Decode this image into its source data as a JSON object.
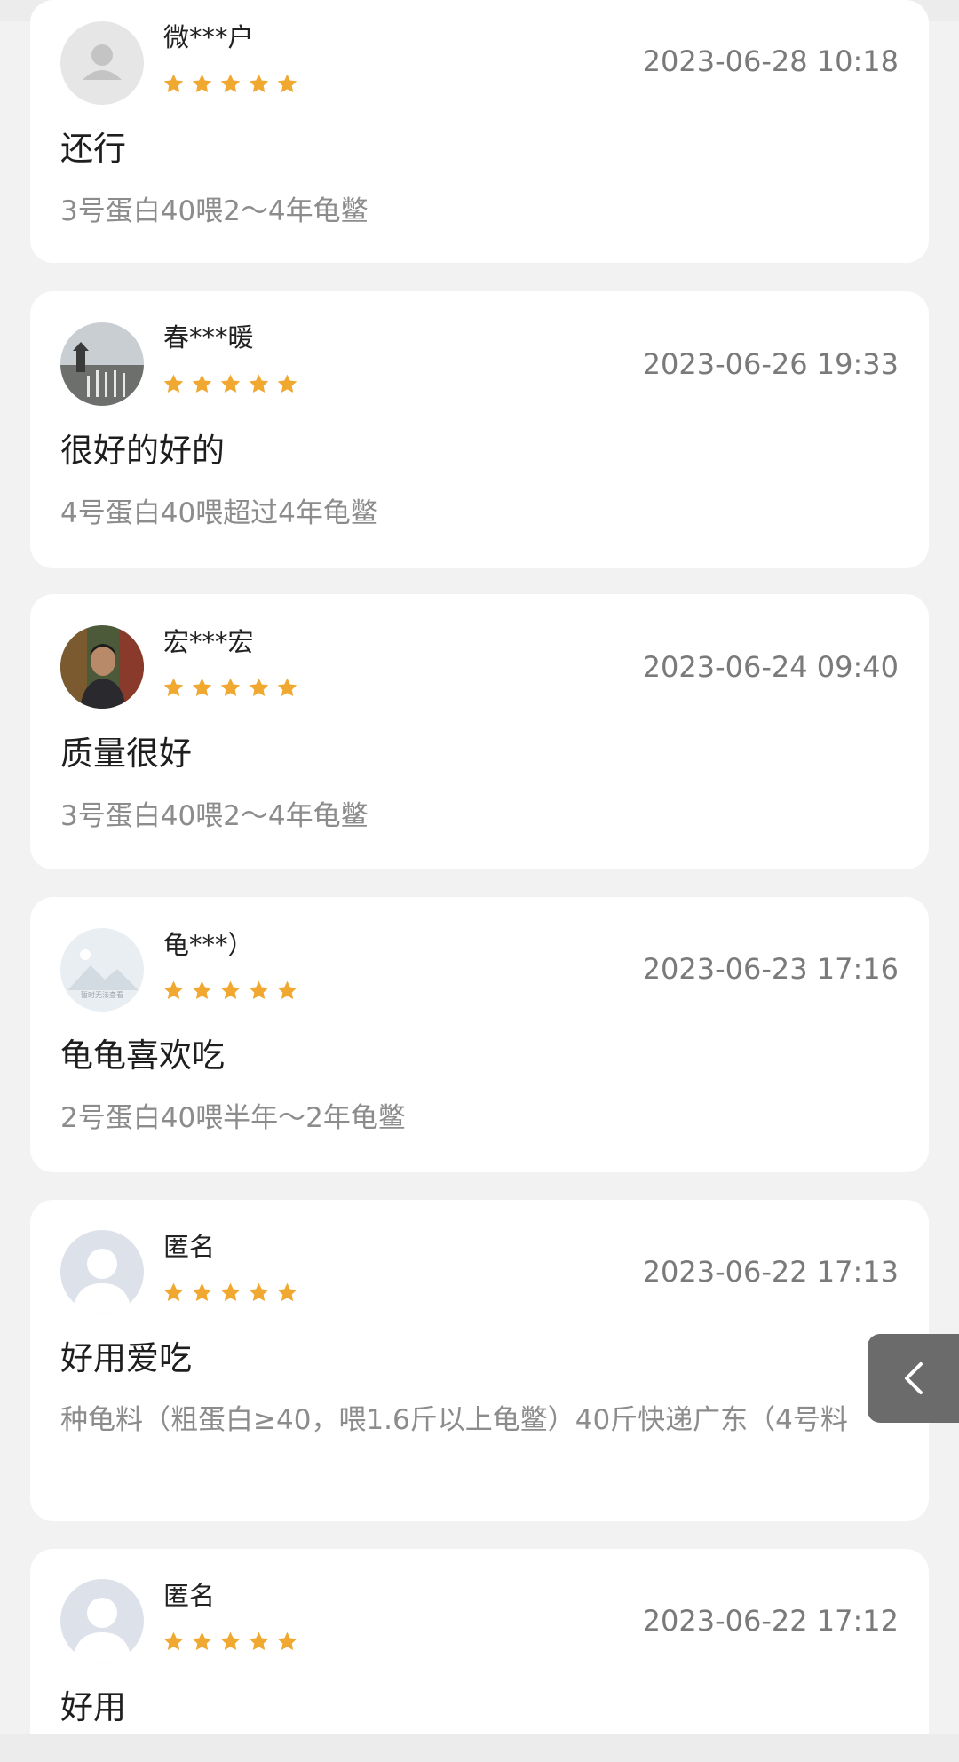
{
  "reviews": [
    {
      "username": "微***户",
      "rating": 5,
      "date": "2023-06-28 10:18",
      "comment": "还行",
      "spec": "3号蛋白40喂2～4年龟鳖",
      "avatar": "default-user-avatar"
    },
    {
      "username": "春***暖",
      "rating": 5,
      "date": "2023-06-26 19:33",
      "comment": "很好的好的",
      "spec": "4号蛋白40喂超过4年龟鳖",
      "avatar": "landscape-photo-avatar"
    },
    {
      "username": "宏***宏",
      "rating": 5,
      "date": "2023-06-24 09:40",
      "comment": "质量很好",
      "spec": "3号蛋白40喂2～4年龟鳖",
      "avatar": "portrait-photo-avatar"
    },
    {
      "username": "龟***）",
      "rating": 5,
      "date": "2023-06-23 17:16",
      "comment": "龟龟喜欢吃",
      "spec": "2号蛋白40喂半年～2年龟鳖",
      "avatar": "image-unavailable-avatar",
      "avatar_caption": "暂时无法查看"
    },
    {
      "username": "匿名",
      "rating": 5,
      "date": "2023-06-22 17:13",
      "comment": "好用爱吃",
      "spec": "种龟料（粗蛋白≥40，喂1.6斤以上龟鳖）40斤快递广东（4号料",
      "avatar": "anonymous-user-avatar"
    },
    {
      "username": "匿名",
      "rating": 5,
      "date": "2023-06-22 17:12",
      "comment": "好用",
      "spec": "",
      "avatar": "anonymous-user-avatar"
    }
  ],
  "floating_button": {
    "icon": "chevron-left-icon"
  },
  "colors": {
    "page_background": "#f2f2f2",
    "card_background": "#ffffff",
    "star": "#f0a830",
    "date_text": "#7a7a7a",
    "spec_text": "#8c8c8c",
    "floating_button": "#6b6b6b"
  }
}
